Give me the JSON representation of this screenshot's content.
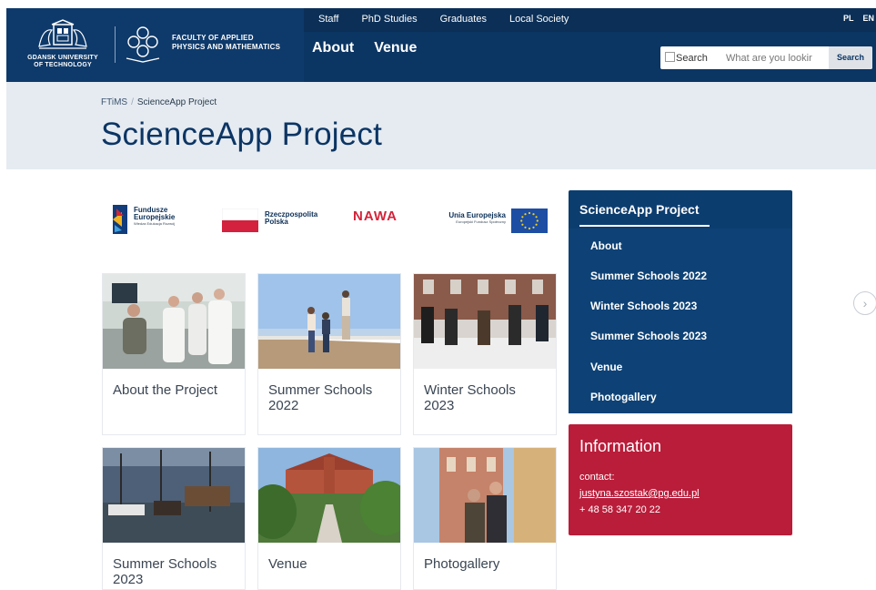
{
  "header": {
    "university_name_line1": "GDANSK UNIVERSITY",
    "university_name_line2": "OF TECHNOLOGY",
    "faculty_name_line1": "FACULTY OF APPLIED",
    "faculty_name_line2": "PHYSICS AND MATHEMATICS",
    "top_nav": [
      "Staff",
      "PhD Studies",
      "Graduates",
      "Local Society"
    ],
    "languages": [
      "PL",
      "EN"
    ],
    "main_nav": [
      "About",
      "Venue"
    ],
    "search": {
      "icon_alt": "Search",
      "placeholder": "What are you lookir",
      "button_label": "Search"
    },
    "colors": {
      "navy": "#0b3563",
      "accent_red": "#b91d3a"
    }
  },
  "breadcrumb": {
    "home": "FTiMS",
    "separator": "/",
    "current": "ScienceApp Project"
  },
  "page_title": "ScienceApp Project",
  "funding_logos": {
    "fe_line1": "Fundusze",
    "fe_line2": "Europejskie",
    "fe_line3": "Wiedza Edukacja Rozwój",
    "rp_line1": "Rzeczpospolita",
    "rp_line2": "Polska",
    "nawa": "NAWA",
    "ue_line1": "Unia Europejska",
    "ue_line2": "Europejski Fundusz Społeczny"
  },
  "cards": [
    {
      "label": "About the Project"
    },
    {
      "label": "Summer Schools 2022"
    },
    {
      "label": "Winter Schools 2023"
    },
    {
      "label": "Summer Schools 2023"
    },
    {
      "label": "Venue"
    },
    {
      "label": "Photogallery"
    }
  ],
  "sidebar": {
    "title": "ScienceApp Project",
    "items": [
      "About",
      "Summer Schools 2022",
      "Winter Schools 2023",
      "Summer Schools 2023",
      "Venue",
      "Photogallery"
    ]
  },
  "info": {
    "title": "Information",
    "contact_label": "contact:",
    "email": "justyna.szostak@pg.edu.pl",
    "phone": "+ 48 58 347 20 22"
  },
  "scroll_arrow_icon": "chevron-right-icon"
}
